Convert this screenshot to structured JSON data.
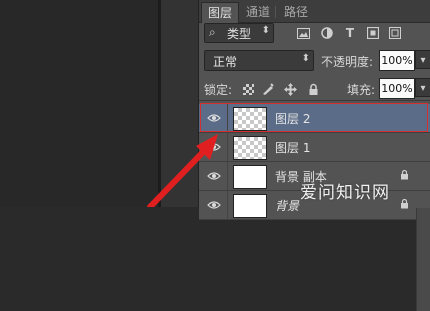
{
  "tabs": [
    {
      "label": "图层",
      "active": true
    },
    {
      "label": "通道",
      "active": false
    },
    {
      "label": "路径",
      "active": false
    }
  ],
  "filter": {
    "kind_label": "类型",
    "icons": [
      "image-filter-icon",
      "adjustment-filter-icon",
      "type-filter-icon",
      "shape-filter-icon",
      "smart-object-filter-icon"
    ]
  },
  "blend": {
    "mode": "正常",
    "opacity_label": "不透明度:",
    "opacity_value": "100%"
  },
  "lock": {
    "label": "锁定:",
    "icons": [
      "lock-transparent-pixels-icon",
      "lock-image-pixels-icon",
      "lock-position-icon",
      "lock-all-icon"
    ],
    "fill_label": "填充:",
    "fill_value": "100%"
  },
  "layers": [
    {
      "name": "图层 2",
      "thumbnail": "transparent",
      "selected": true,
      "locked": false,
      "visible": true
    },
    {
      "name": "图层 1",
      "thumbnail": "transparent",
      "selected": false,
      "locked": false,
      "visible": true
    },
    {
      "name": "背景 副本",
      "thumbnail": "white",
      "selected": false,
      "locked": true,
      "visible": true
    },
    {
      "name": "背景",
      "thumbnail": "white",
      "selected": false,
      "locked": true,
      "visible": true
    }
  ],
  "watermark": "爱问知识网",
  "colors": {
    "panel_bg": "#535353",
    "selected_layer_bg": "#5b6c88",
    "highlight_border": "#d43030",
    "arrow": "#e02020"
  }
}
